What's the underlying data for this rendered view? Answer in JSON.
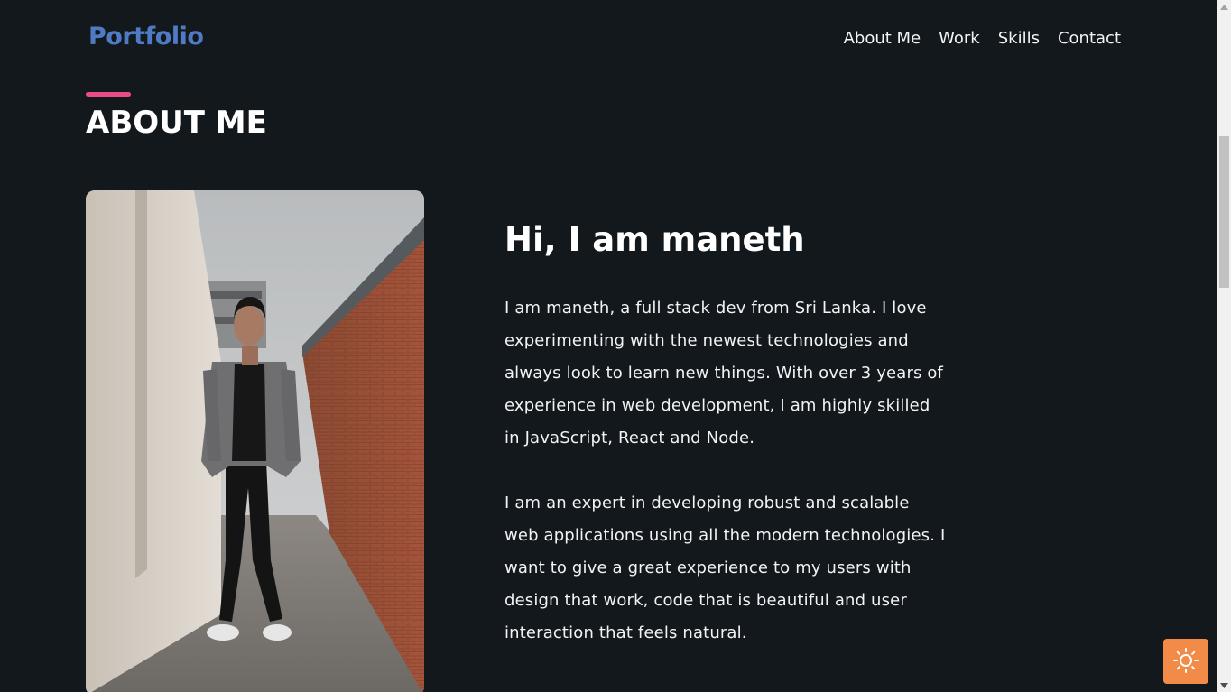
{
  "nav": {
    "logo": "Portfolio",
    "links": [
      "About Me",
      "Work",
      "Skills",
      "Contact"
    ]
  },
  "about": {
    "section_title": "ABOUT ME",
    "greeting": "Hi, I am maneth",
    "paragraphs": [
      "I am maneth, a full stack dev from Sri Lanka. I love experimenting with the newest technologies and always look to learn new things. With over 3 years of experience in web development, I am highly skilled in JavaScript, React and Node.",
      "I am an expert in developing robust and scalable web applications using all the modern technologies. I want to give a great experience to my users with design that work, code that is beautiful and user interaction that feels natural."
    ],
    "photo_icon": "profile-photo"
  },
  "theme_toggle": {
    "icon": "sun-icon"
  },
  "colors": {
    "background": "#13181d",
    "logo": "#4f7bc4",
    "accent": "#ea4c89",
    "toggle": "#f28a48"
  }
}
